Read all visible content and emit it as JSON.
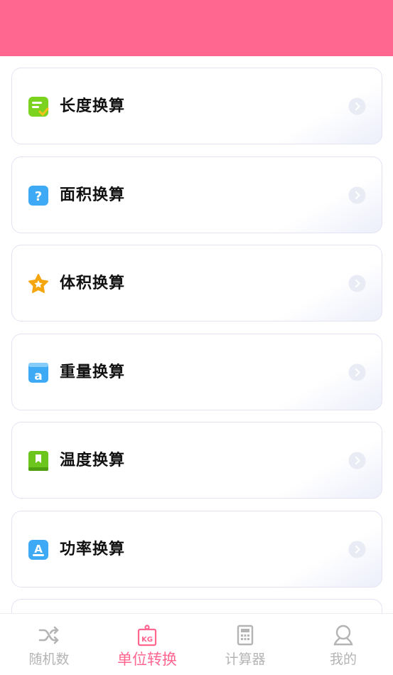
{
  "header": {
    "color": "#ff6690"
  },
  "list": {
    "items": [
      {
        "label": "长度换算",
        "icon": "notes-check-icon"
      },
      {
        "label": "面积换算",
        "icon": "question-icon"
      },
      {
        "label": "体积换算",
        "icon": "star-icon"
      },
      {
        "label": "重量换算",
        "icon": "letter-a-icon"
      },
      {
        "label": "温度换算",
        "icon": "bookmark-icon"
      },
      {
        "label": "功率换算",
        "icon": "letter-a-box-icon"
      }
    ]
  },
  "tabbar": {
    "active_color": "#ff6690",
    "items": [
      {
        "label": "随机数",
        "icon": "shuffle-icon",
        "active": false
      },
      {
        "label": "单位转换",
        "icon": "kg-weight-icon",
        "active": true
      },
      {
        "label": "计算器",
        "icon": "calculator-icon",
        "active": false
      },
      {
        "label": "我的",
        "icon": "user-icon",
        "active": false
      }
    ]
  }
}
